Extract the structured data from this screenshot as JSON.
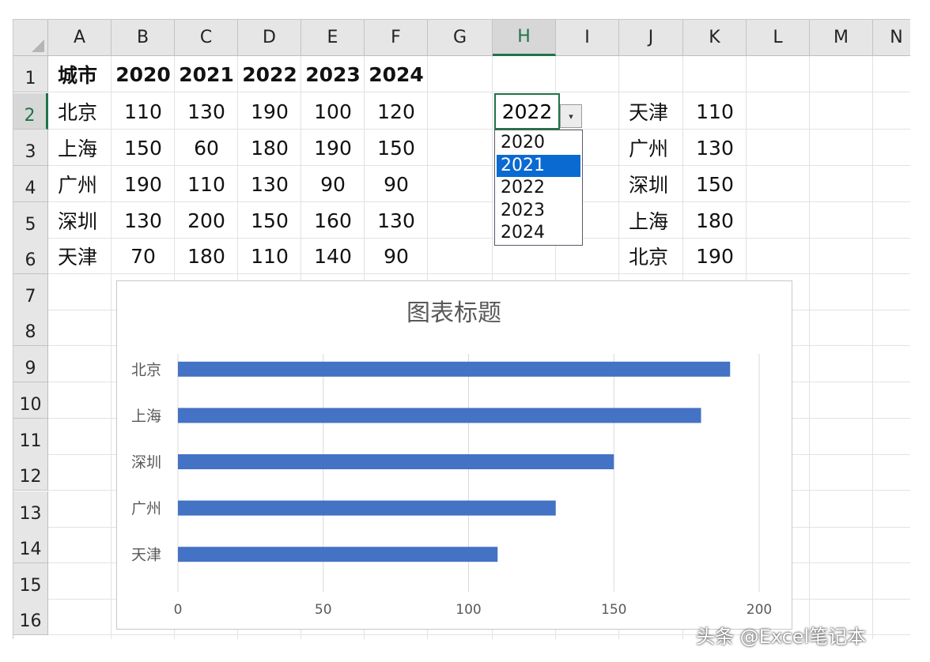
{
  "columns": [
    "A",
    "B",
    "C",
    "D",
    "E",
    "F",
    "G",
    "H",
    "I",
    "J",
    "K",
    "L",
    "M",
    "N"
  ],
  "selected_column": "H",
  "rows": [
    "1",
    "2",
    "3",
    "4",
    "5",
    "6",
    "7",
    "8",
    "9",
    "10",
    "11",
    "12",
    "13",
    "14",
    "15",
    "16"
  ],
  "selected_row": "2",
  "table": {
    "header": [
      "城市",
      "2020",
      "2021",
      "2022",
      "2023",
      "2024"
    ],
    "rows": [
      [
        "北京",
        "110",
        "130",
        "190",
        "100",
        "120"
      ],
      [
        "上海",
        "150",
        "60",
        "180",
        "190",
        "150"
      ],
      [
        "广州",
        "190",
        "110",
        "130",
        "90",
        "90"
      ],
      [
        "深圳",
        "130",
        "200",
        "150",
        "160",
        "130"
      ],
      [
        "天津",
        "70",
        "180",
        "110",
        "140",
        "90"
      ]
    ]
  },
  "selector": {
    "value": "2022",
    "arrow_label": "▾",
    "options": [
      "2020",
      "2021",
      "2022",
      "2023",
      "2024"
    ],
    "highlighted": "2021"
  },
  "sorted_table": [
    [
      "天津",
      "110"
    ],
    [
      "广州",
      "130"
    ],
    [
      "深圳",
      "150"
    ],
    [
      "上海",
      "180"
    ],
    [
      "北京",
      "190"
    ]
  ],
  "chart_data": {
    "type": "bar",
    "orientation": "horizontal",
    "title": "图表标题",
    "categories": [
      "北京",
      "上海",
      "深圳",
      "广州",
      "天津"
    ],
    "values": [
      190,
      180,
      150,
      130,
      110
    ],
    "xlim": [
      0,
      200
    ],
    "xticks": [
      "0",
      "50",
      "100",
      "150",
      "200"
    ],
    "grid": true,
    "bar_color": "#4472c4"
  },
  "watermark": "头条 @Excel笔记本"
}
